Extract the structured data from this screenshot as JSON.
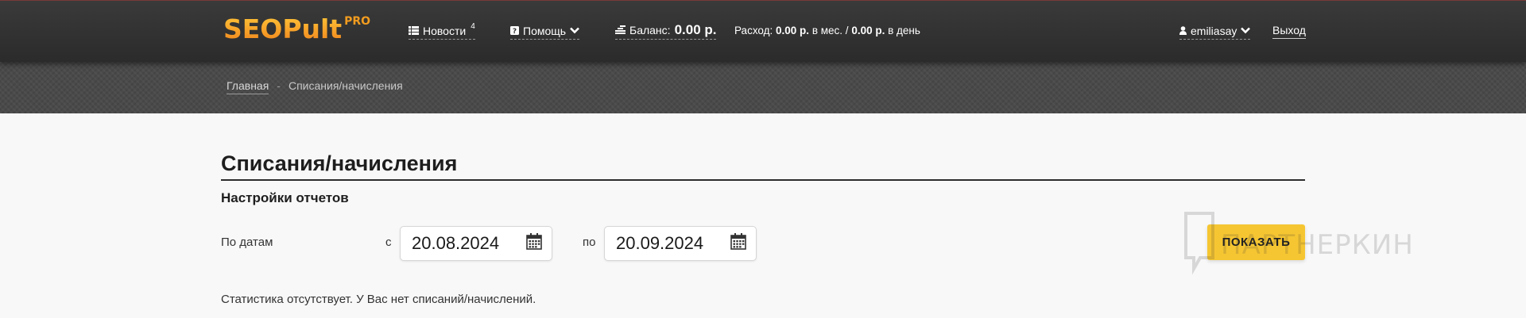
{
  "header": {
    "logo": {
      "word": "SEOPult",
      "badge": "PRO"
    },
    "news": {
      "label": "Новости",
      "count": "4"
    },
    "help": {
      "label": "Помощь"
    },
    "balance": {
      "label": "Баланс:",
      "value": "0.00 р."
    },
    "expense": {
      "label": "Расход:",
      "month_value": "0.00 р.",
      "month_suffix": "в мес. /",
      "day_value": "0.00 р.",
      "day_suffix": "в день"
    },
    "user": {
      "name": "emiliasay"
    },
    "exit_label": "Выход"
  },
  "breadcrumb": {
    "home": "Главная",
    "separator": "-",
    "current": "Списания/начисления"
  },
  "main": {
    "title": "Списания/начисления",
    "section_title": "Настройки отчетов",
    "date_filter": {
      "label": "По датам",
      "from_label": "с",
      "from_value": "20.08.2024",
      "to_label": "по",
      "to_value": "20.09.2024"
    },
    "show_button": "ПОКАЗАТЬ",
    "empty_message": "Статистика отсутствует. У Вас нет списаний/начислений."
  },
  "watermark": {
    "text": "ПАРТНЕРКИН"
  },
  "colors": {
    "header_bg": "#2f2f2f",
    "logo_orange": "#f29c1f",
    "button_yellow": "#f6c632",
    "page_bg": "#f8f8f8"
  },
  "icons": {
    "news": "list-icon",
    "help": "question-icon",
    "help_chevron": "chevron-down-icon",
    "balance": "coins-icon",
    "user": "user-icon",
    "user_chevron": "chevron-down-icon",
    "date": "calendar-icon"
  }
}
